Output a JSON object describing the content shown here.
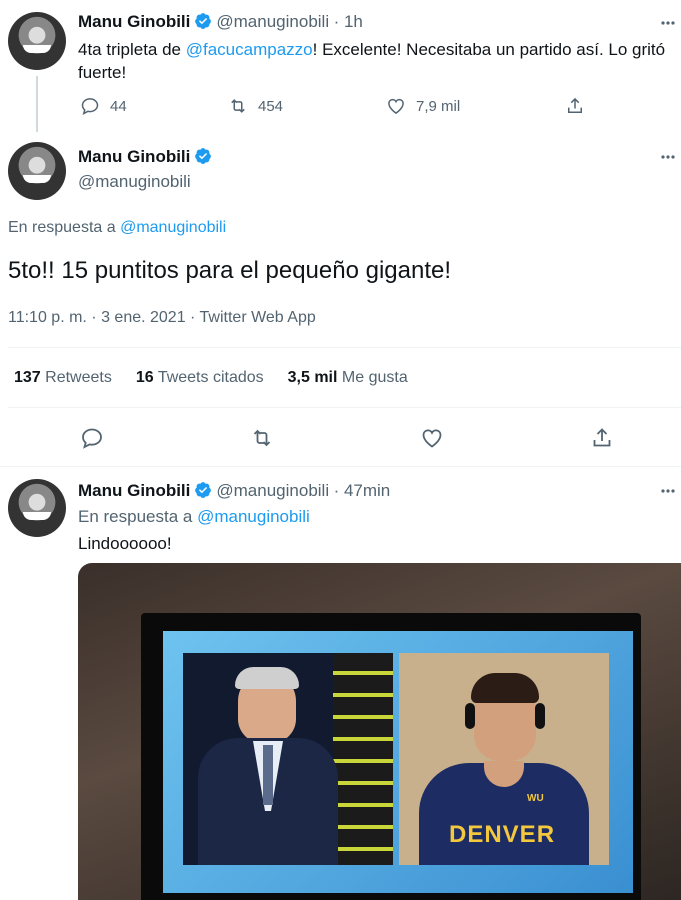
{
  "tweet1": {
    "name": "Manu Ginobili",
    "handle": "@manuginobili",
    "time": "· 1h",
    "text_before": "4ta tripleta de ",
    "mention": "@facucampazzo",
    "text_after": "! Excelente! Necesitaba un partido así. Lo gritó fuerte!",
    "replies": "44",
    "retweets": "454",
    "likes": "7,9 mil"
  },
  "tweet2": {
    "name": "Manu Ginobili",
    "handle": "@manuginobili",
    "reply_prefix": "En respuesta a ",
    "reply_to": "@manuginobili",
    "text": "5to!! 15 puntitos para el pequeño gigante!",
    "meta": "11:10 p. m. · 3 ene. 2021 · Twitter Web App",
    "retweets_count": "137",
    "retweets_label": "Retweets",
    "quotes_count": "16",
    "quotes_label": "Tweets citados",
    "likes_count": "3,5 mil",
    "likes_label": "Me gusta"
  },
  "tweet3": {
    "name": "Manu Ginobili",
    "handle": "@manuginobili",
    "time": "· 47min",
    "reply_prefix": "En respuesta a ",
    "reply_to": "@manuginobili",
    "text": "Lindoooooo!",
    "jersey_text": "DENVER",
    "jersey_badge": "WU"
  },
  "colors": {
    "accent": "#1d9bf0",
    "muted": "#536471"
  }
}
